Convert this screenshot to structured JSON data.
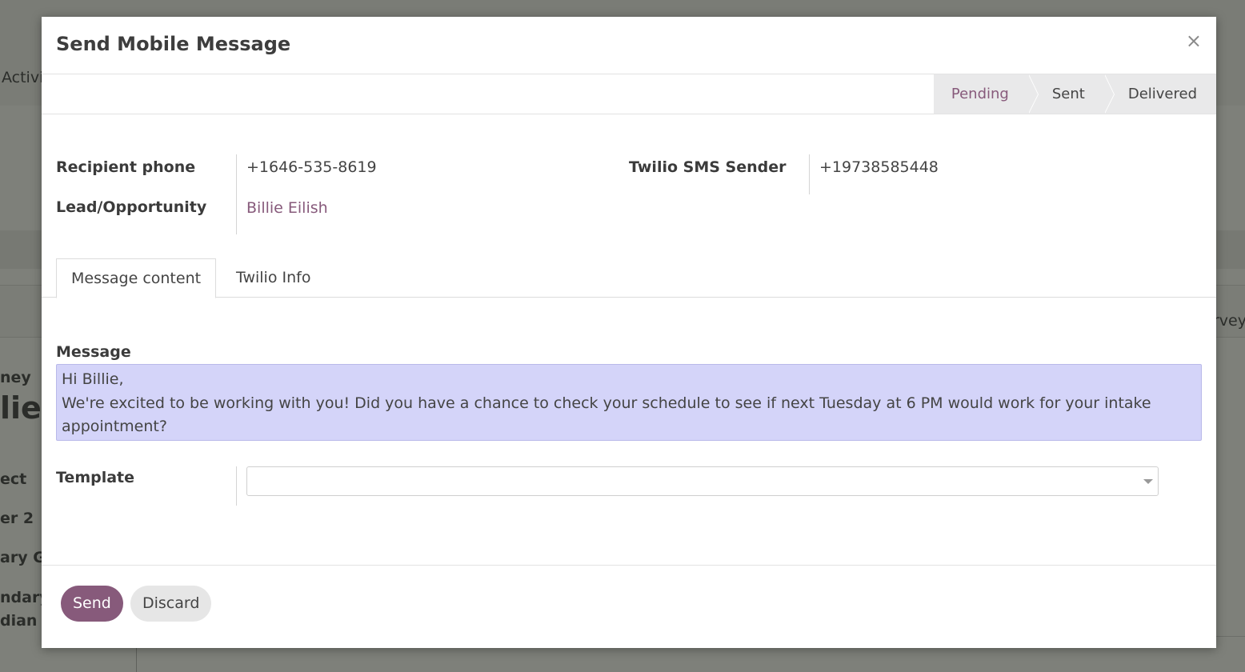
{
  "background": {
    "activity_fragment": "Activi",
    "survey_fragment": "rvey",
    "journey_fragment": "ney",
    "name_fragment": "lie",
    "prospect_fragment": "ect",
    "member_fragment": "er 2",
    "guardian1_fragment": "ary Gu",
    "guardian2_line1": "ndary",
    "guardian2_line2": "dian"
  },
  "modal": {
    "title": "Send Mobile Message",
    "close_glyph": "×"
  },
  "statusbar": {
    "stages": [
      {
        "label": "Pending",
        "active": true
      },
      {
        "label": "Sent",
        "active": false
      },
      {
        "label": "Delivered",
        "active": false
      }
    ]
  },
  "fields": {
    "recipient_phone": {
      "label": "Recipient phone",
      "value": "+1646-535-8619"
    },
    "lead": {
      "label": "Lead/Opportunity",
      "value": "Billie Eilish"
    },
    "twilio_sender": {
      "label": "Twilio SMS Sender",
      "value": "+19738585448"
    }
  },
  "tabs": [
    {
      "label": "Message content",
      "active": true
    },
    {
      "label": "Twilio Info",
      "active": false
    }
  ],
  "message": {
    "label": "Message",
    "lines": [
      "Hi Billie,",
      "We're excited to be working with you! Did you have a chance to check your schedule to see if next Tuesday at 6 PM would work for your intake",
      "appointment?"
    ]
  },
  "template": {
    "label": "Template",
    "value": ""
  },
  "footer": {
    "send_label": "Send",
    "discard_label": "Discard"
  },
  "colors": {
    "brand": "#875a7b",
    "message_bg": "#d4d4f9",
    "stage_bg": "#e9e9ea"
  }
}
